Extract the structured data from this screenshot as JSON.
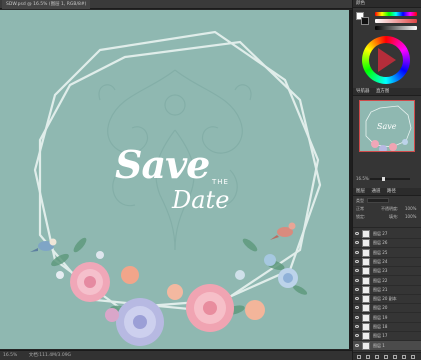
{
  "document": {
    "tab_title": "SDW.psd @ 16.5% (图层 1, RGB/8#)",
    "status_zoom": "16.5%",
    "status_doc": "文档:111.4M/3.09G"
  },
  "artwork": {
    "save_word": "Save",
    "the_word": "THE",
    "date_word": "Date",
    "background_color": "#8fb8b1"
  },
  "color_panel": {
    "title": "颜色",
    "foreground": "#ffffff",
    "background": "#111111"
  },
  "navigator_panel": {
    "tabs": [
      "导航器",
      "直方图"
    ],
    "zoom": "16.5%"
  },
  "layers_panel": {
    "tabs": [
      "图层",
      "通道",
      "路径"
    ],
    "kind_label": "类型",
    "blend_mode": "正常",
    "opacity_label": "不透明度:",
    "opacity": "100%",
    "lock_label": "锁定:",
    "fill_label": "填充:",
    "fill": "100%",
    "layers": [
      {
        "name": "图层 27",
        "selected": false
      },
      {
        "name": "图层 26",
        "selected": false
      },
      {
        "name": "图层 25",
        "selected": false
      },
      {
        "name": "图层 24",
        "selected": false
      },
      {
        "name": "图层 23",
        "selected": false
      },
      {
        "name": "图层 22",
        "selected": false
      },
      {
        "name": "图层 21",
        "selected": false
      },
      {
        "name": "图层 20 副本",
        "selected": false
      },
      {
        "name": "图层 20",
        "selected": false
      },
      {
        "name": "图层 19",
        "selected": false
      },
      {
        "name": "图层 18",
        "selected": false
      },
      {
        "name": "图层 17",
        "selected": false
      },
      {
        "name": "图层 1",
        "selected": true
      }
    ]
  }
}
